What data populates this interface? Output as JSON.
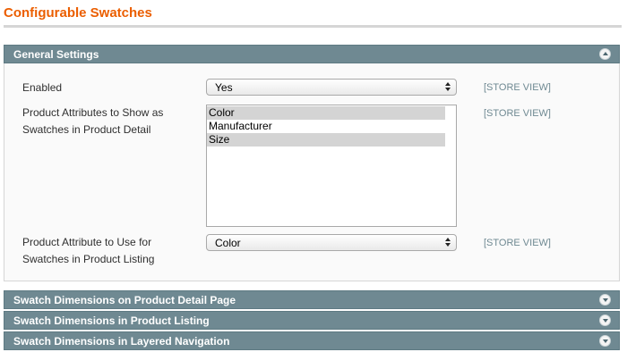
{
  "page": {
    "title": "Configurable Swatches"
  },
  "general": {
    "header": "General Settings",
    "fields": {
      "enabled": {
        "label": "Enabled",
        "value": "Yes",
        "scope": "[STORE VIEW]"
      },
      "detail": {
        "label_line1": "Product Attributes to Show as",
        "label_line2": "Swatches in Product Detail",
        "scope": "[STORE VIEW]",
        "options": [
          {
            "label": "Color",
            "selected": true
          },
          {
            "label": "Manufacturer",
            "selected": false
          },
          {
            "label": "Size",
            "selected": true
          }
        ]
      },
      "listing": {
        "label_line1": "Product Attribute to Use for",
        "label_line2": "Swatches in Product Listing",
        "value": "Color",
        "scope": "[STORE VIEW]"
      }
    }
  },
  "sections": {
    "detail_dims": "Swatch Dimensions on Product Detail Page",
    "listing_dims": "Swatch Dimensions in Product Listing",
    "layered_dims": "Swatch Dimensions in Layered Navigation"
  },
  "colors": {
    "title": "#eb5e00",
    "section_header": "#6f8992",
    "scope_text": "#6f8992"
  }
}
